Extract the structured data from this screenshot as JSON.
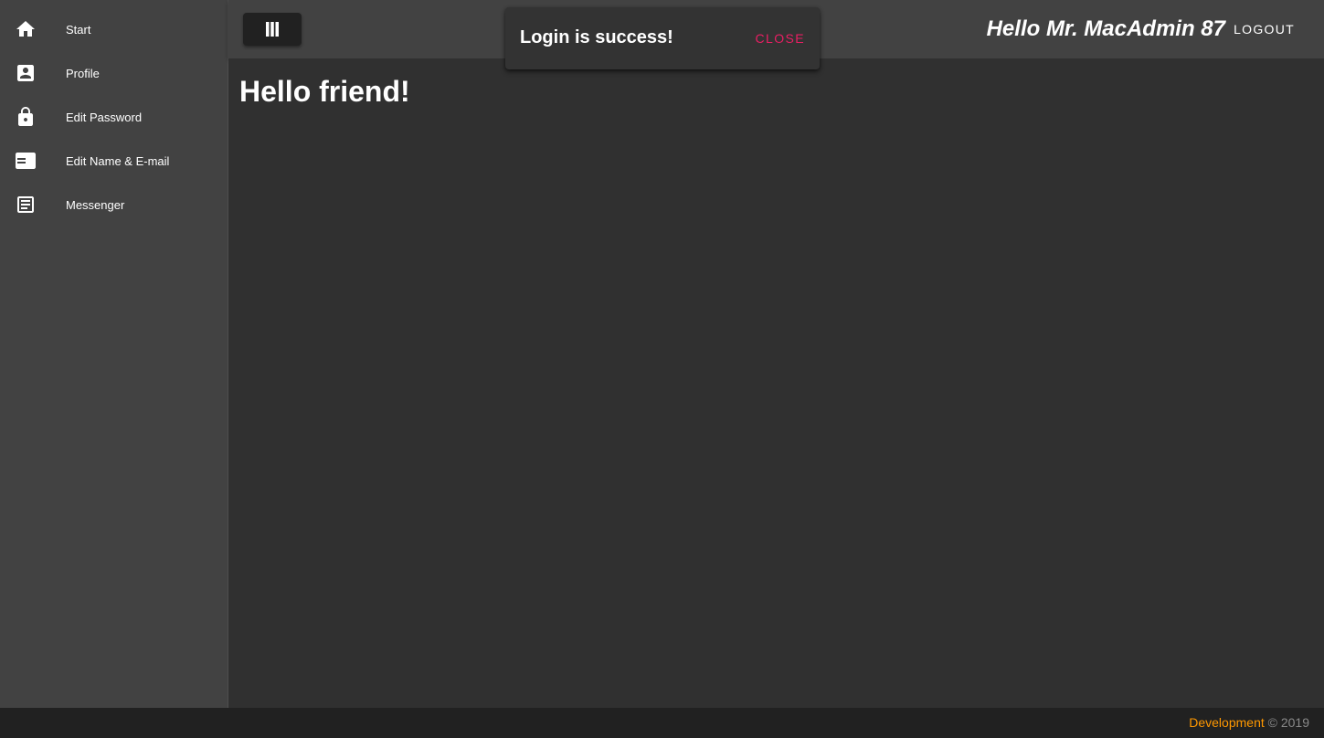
{
  "sidebar": {
    "items": [
      {
        "label": "Start",
        "icon": "home-icon"
      },
      {
        "label": "Profile",
        "icon": "account-box-icon"
      },
      {
        "label": "Edit Password",
        "icon": "lock-icon"
      },
      {
        "label": "Edit Name & E-mail",
        "icon": "featured-play-list-icon"
      },
      {
        "label": "Messenger",
        "icon": "subject-icon"
      }
    ]
  },
  "header": {
    "menu_icon": "view-column-icon",
    "greeting": "Hello Mr. MacAdmin 87",
    "logout_label": "LOGOUT"
  },
  "snackbar": {
    "message": "Login is success!",
    "action_label": "CLOSE",
    "action_color": "#e91e63"
  },
  "main": {
    "title": "Hello friend!"
  },
  "footer": {
    "link_label": "Development",
    "copyright": "© 2019",
    "link_color": "#ff9800"
  },
  "colors": {
    "sidebar_bg": "#424242",
    "content_bg": "#303030",
    "footer_bg": "#212121"
  }
}
